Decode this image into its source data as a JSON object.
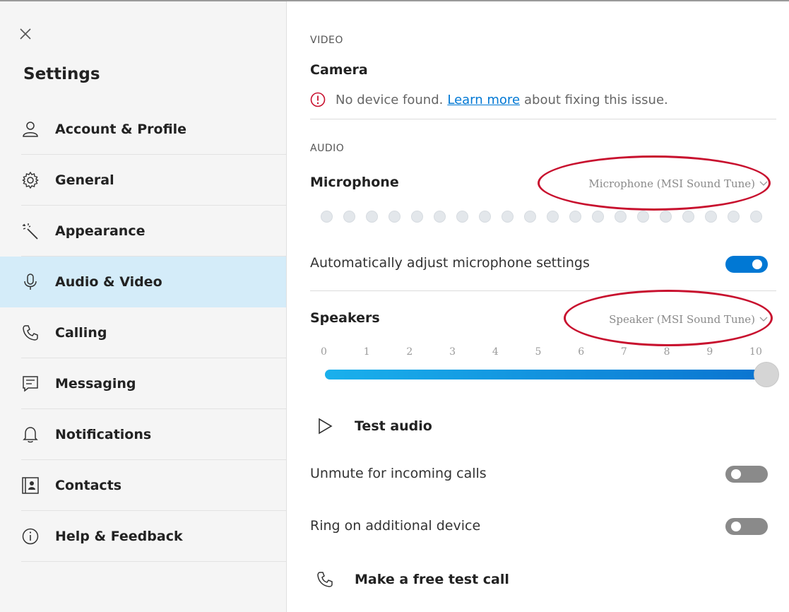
{
  "sidebar": {
    "title": "Settings",
    "items": [
      {
        "label": "Account & Profile",
        "icon": "person-icon",
        "selected": false
      },
      {
        "label": "General",
        "icon": "gear-icon",
        "selected": false
      },
      {
        "label": "Appearance",
        "icon": "magic-wand-icon",
        "selected": false
      },
      {
        "label": "Audio & Video",
        "icon": "microphone-icon",
        "selected": true
      },
      {
        "label": "Calling",
        "icon": "phone-icon",
        "selected": false
      },
      {
        "label": "Messaging",
        "icon": "message-icon",
        "selected": false
      },
      {
        "label": "Notifications",
        "icon": "bell-icon",
        "selected": false
      },
      {
        "label": "Contacts",
        "icon": "contact-card-icon",
        "selected": false
      },
      {
        "label": "Help & Feedback",
        "icon": "info-icon",
        "selected": false
      }
    ]
  },
  "video": {
    "section": "VIDEO",
    "camera_title": "Camera",
    "camera_msg_prefix": "No device found.",
    "camera_link": "Learn more",
    "camera_msg_suffix": "about fixing this issue."
  },
  "audio": {
    "section": "AUDIO",
    "microphone_title": "Microphone",
    "microphone_device": "Microphone (MSI Sound Tune)",
    "mic_level_dots": 20,
    "auto_adjust_label": "Automatically adjust microphone settings",
    "auto_adjust_on": true,
    "speakers_title": "Speakers",
    "speaker_device": "Speaker (MSI Sound Tune)",
    "volume_ticks": [
      "0",
      "1",
      "2",
      "3",
      "4",
      "5",
      "6",
      "7",
      "8",
      "9",
      "10"
    ],
    "volume_value": 10,
    "test_audio_label": "Test audio",
    "unmute_label": "Unmute for incoming calls",
    "unmute_on": false,
    "ring_label": "Ring on additional device",
    "ring_on": false,
    "test_call_label": "Make a free test call"
  },
  "colors": {
    "accent": "#0078d4",
    "selected_bg": "#d4ecf9",
    "annotation_red": "#c8102e"
  }
}
